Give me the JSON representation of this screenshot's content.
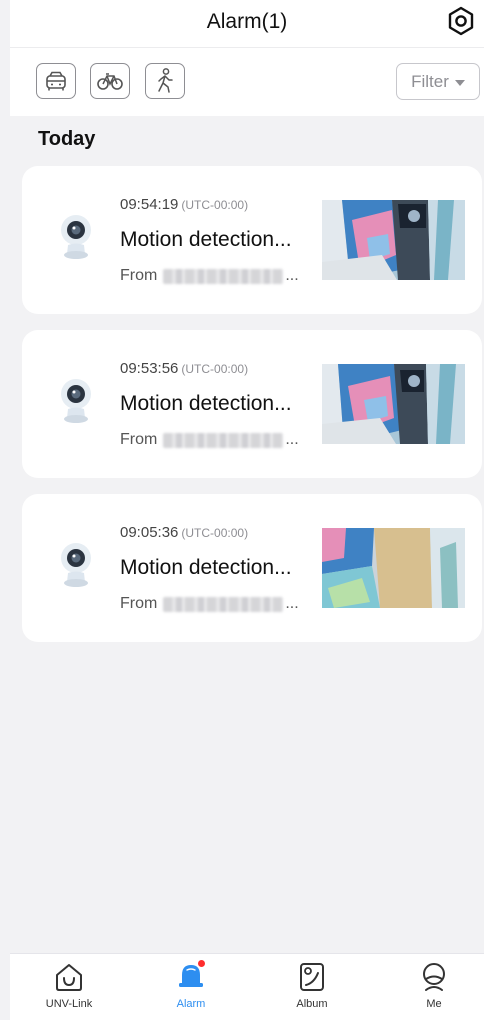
{
  "header": {
    "title": "Alarm(1)",
    "settings_icon": "settings-hex-icon",
    "filter_label": "Filter",
    "type_filters": [
      {
        "name": "vehicle-filter",
        "icon": "car-icon"
      },
      {
        "name": "bicycle-filter",
        "icon": "bicycle-icon"
      },
      {
        "name": "person-filter",
        "icon": "walking-person-icon"
      }
    ]
  },
  "section": {
    "title": "Today"
  },
  "alarms": [
    {
      "time": "09:54:19",
      "tz": "(UTC-00:00)",
      "title": "Motion detection...",
      "from_label": "From",
      "ellipsis": "...",
      "device_icon": "camera-icon"
    },
    {
      "time": "09:53:56",
      "tz": "(UTC-00:00)",
      "title": "Motion detection...",
      "from_label": "From",
      "ellipsis": "...",
      "device_icon": "camera-icon"
    },
    {
      "time": "09:05:36",
      "tz": "(UTC-00:00)",
      "title": "Motion detection...",
      "from_label": "From",
      "ellipsis": "...",
      "device_icon": "camera-icon"
    }
  ],
  "tabbar": {
    "tabs": [
      {
        "label": "UNV-Link",
        "icon": "home-icon",
        "active": false
      },
      {
        "label": "Alarm",
        "icon": "alarm-bell-icon",
        "active": true
      },
      {
        "label": "Album",
        "icon": "album-icon",
        "active": false
      },
      {
        "label": "Me",
        "icon": "user-icon",
        "active": false
      }
    ]
  },
  "colors": {
    "accent": "#2d8ef0",
    "badge": "#ff2d2d",
    "background": "#f2f2f4",
    "card": "#ffffff"
  }
}
